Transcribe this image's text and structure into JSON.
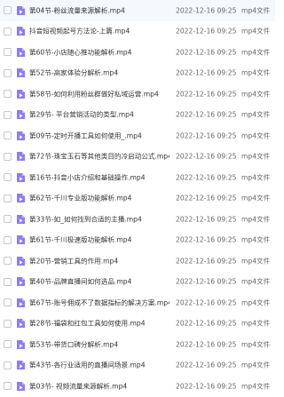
{
  "files": [
    {
      "name": "第04节-粉丝流量来源解析.mp4",
      "date": "2022-12-16 09:25",
      "type": "mp4文件",
      "icon": "video-file-icon"
    },
    {
      "name": "抖音短视频起号方法论-上篇.mp4",
      "date": "2022-12-16 09:25",
      "type": "mp4文件",
      "icon": "video-file-icon"
    },
    {
      "name": "第60节-小店随心推功能解析.mp4",
      "date": "2022-12-16 09:25",
      "type": "mp4文件",
      "icon": "video-file-icon"
    },
    {
      "name": "第52节-高家体验分解析.mp4",
      "date": "2022-12-16 09:25",
      "type": "mp4文件",
      "icon": "video-file-icon"
    },
    {
      "name": "第58节-如何利用粉丝群做好私域运营.mp4",
      "date": "2022-12-16 09:25",
      "type": "mp4文件",
      "icon": "video-file-icon"
    },
    {
      "name": "第29节- 平台营销活动的类型.mp4",
      "date": "2022-12-16 09:25",
      "type": "mp4文件",
      "icon": "video-file-icon"
    },
    {
      "name": "第09节-定时开播工具如何使用_.mp4",
      "date": "2022-12-16 09:25",
      "type": "mp4文件",
      "icon": "video-file-icon"
    },
    {
      "name": "第72节-珠宝玉石等其他类目的冷启动公式.mp4",
      "date": "2022-12-16 09:25",
      "type": "mp4文件",
      "icon": "video-file-icon"
    },
    {
      "name": "第16节-抖音小店介绍和基础操作.mp4",
      "date": "2022-12-16 09:25",
      "type": "mp4文件",
      "icon": "video-file-icon"
    },
    {
      "name": "第62节-千川专业版功能解析.mp4",
      "date": "2022-12-16 09:25",
      "type": "mp4文件",
      "icon": "video-file-icon"
    },
    {
      "name": "第33节-如_如何找到合适的主播.mp4",
      "date": "2022-12-16 09:25",
      "type": "mp4文件",
      "icon": "video-file-icon"
    },
    {
      "name": "第61节-千川极速版功能解析.mp4",
      "date": "2022-12-16 09:25",
      "type": "mp4文件",
      "icon": "video-file-icon"
    },
    {
      "name": "第20节-营销工具的作用.mp4",
      "date": "2022-12-16 09:25",
      "type": "mp4文件",
      "icon": "video-file-icon"
    },
    {
      "name": "第40节-品牌直播间如何选品.mp4",
      "date": "2022-12-16 09:25",
      "type": "mp4文件",
      "icon": "video-file-icon"
    },
    {
      "name": "第67节-账号佣成不了数据指标的解决方案.mp4",
      "date": "2022-12-16 09:25",
      "type": "mp4文件",
      "icon": "video-file-icon"
    },
    {
      "name": "第28节-福袋和红包工具如何使用.mp4",
      "date": "2022-12-16 09:25",
      "type": "mp4文件",
      "icon": "video-file-icon"
    },
    {
      "name": "第53节-带货口碑分解析.mp4",
      "date": "2022-12-16 09:25",
      "type": "mp4文件",
      "icon": "video-file-icon"
    },
    {
      "name": "第43节-各行业适用的直播间场景.mp4",
      "date": "2022-12-16 09:25",
      "type": "mp4文件",
      "icon": "video-file-icon"
    },
    {
      "name": "第03节- 视频流量来源解析.mp4",
      "date": "2022-12-16 09:25",
      "type": "mp4文件",
      "icon": "video-file-icon"
    }
  ],
  "colors": {
    "icon_purple": "#8b7cf6",
    "icon_fold": "#c4bbfb",
    "text_primary": "#333333",
    "text_secondary": "#666666"
  }
}
